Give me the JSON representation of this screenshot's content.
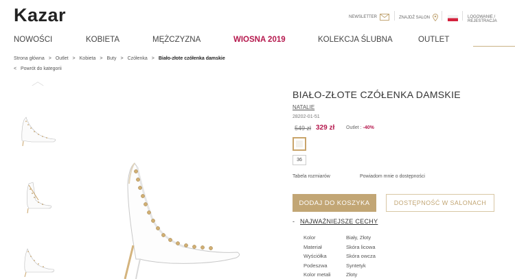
{
  "header": {
    "logo": "Kazar",
    "newsletter": "NEWSLETTER",
    "find_salon": "ZNAJDŹ SALON",
    "login": "LOGOWANIE / REJESTRACJA"
  },
  "nav": {
    "items": [
      "NOWOŚCI",
      "KOBIETA",
      "MĘŻCZYZNA",
      "WIOSNA 2019",
      "KOLEKCJA ŚLUBNA",
      "OUTLET"
    ]
  },
  "breadcrumb": [
    "Strona główna",
    "Outlet",
    "Kobieta",
    "Buty",
    "Czółenka",
    "Biało-złote czółenka damskie"
  ],
  "breadcrumb_sep": ">",
  "back_link": "Powrót do kategorii",
  "back_arrow": "<",
  "product": {
    "title": "BIAŁO-ZŁOTE CZÓŁENKA DAMSKIE",
    "brand": "NATALIE",
    "sku": "28202-01-51",
    "old_price": "549 zł",
    "new_price": "329 zł",
    "outlet_label": "Outlet :",
    "outlet_discount": "-40%",
    "size": "36",
    "size_table": "Tabela rozmiarów",
    "notify": "Powiadom mnie o dostępności",
    "add_to_cart": "DODAJ DO KOSZYKA",
    "availability": "DOSTĘPNOŚĆ W SALONACH",
    "features_toggle": "-",
    "features_title": "NAJWAŻNIEJSZE CECHY",
    "specs": [
      {
        "k": "Kolor",
        "v": "Biały, Złoty"
      },
      {
        "k": "Materiał",
        "v": "Skóra licowa"
      },
      {
        "k": "Wyściółka",
        "v": "Skóra owcza"
      },
      {
        "k": "Podeszwa",
        "v": "Syntetyk"
      },
      {
        "k": "Kolor metali",
        "v": "Złoty"
      }
    ]
  },
  "colors": {
    "accent": "#b5184d",
    "gold": "#c2a675"
  }
}
